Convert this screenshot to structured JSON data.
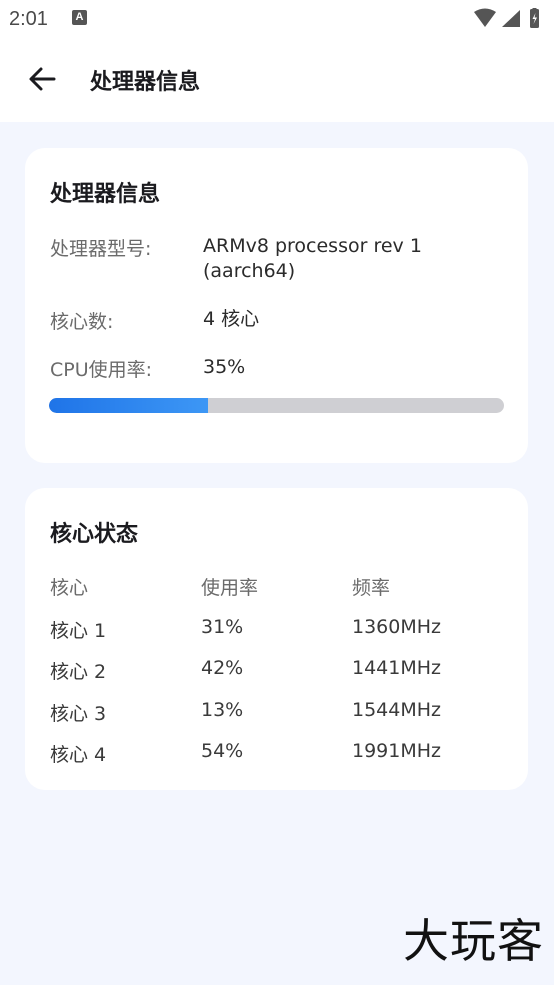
{
  "status_bar": {
    "time": "2:01",
    "notification_icon": "a-notification-icon",
    "notification_letter": "A",
    "icons": [
      "wifi-icon",
      "signal-icon",
      "battery-icon"
    ]
  },
  "app_bar": {
    "back_icon": "arrow-left-icon",
    "title": "处理器信息"
  },
  "processor_card": {
    "title": "处理器信息",
    "model_label": "处理器型号:",
    "model_value": "ARMv8 processor rev 1 (aarch64)",
    "cores_label": "核心数:",
    "cores_value": "4 核心",
    "cpu_usage_label": "CPU使用率:",
    "cpu_usage_value": "35%",
    "cpu_usage_fraction": 0.35,
    "accent_color": "#1f74e8"
  },
  "cores_card": {
    "title": "核心状态",
    "headers": [
      "核心",
      "使用率",
      "频率"
    ],
    "rows": [
      [
        "核心 1",
        "31%",
        "1360MHz"
      ],
      [
        "核心 2",
        "42%",
        "1441MHz"
      ],
      [
        "核心 3",
        "13%",
        "1544MHz"
      ],
      [
        "核心 4",
        "54%",
        "1991MHz"
      ]
    ]
  },
  "watermark": "大玩客"
}
